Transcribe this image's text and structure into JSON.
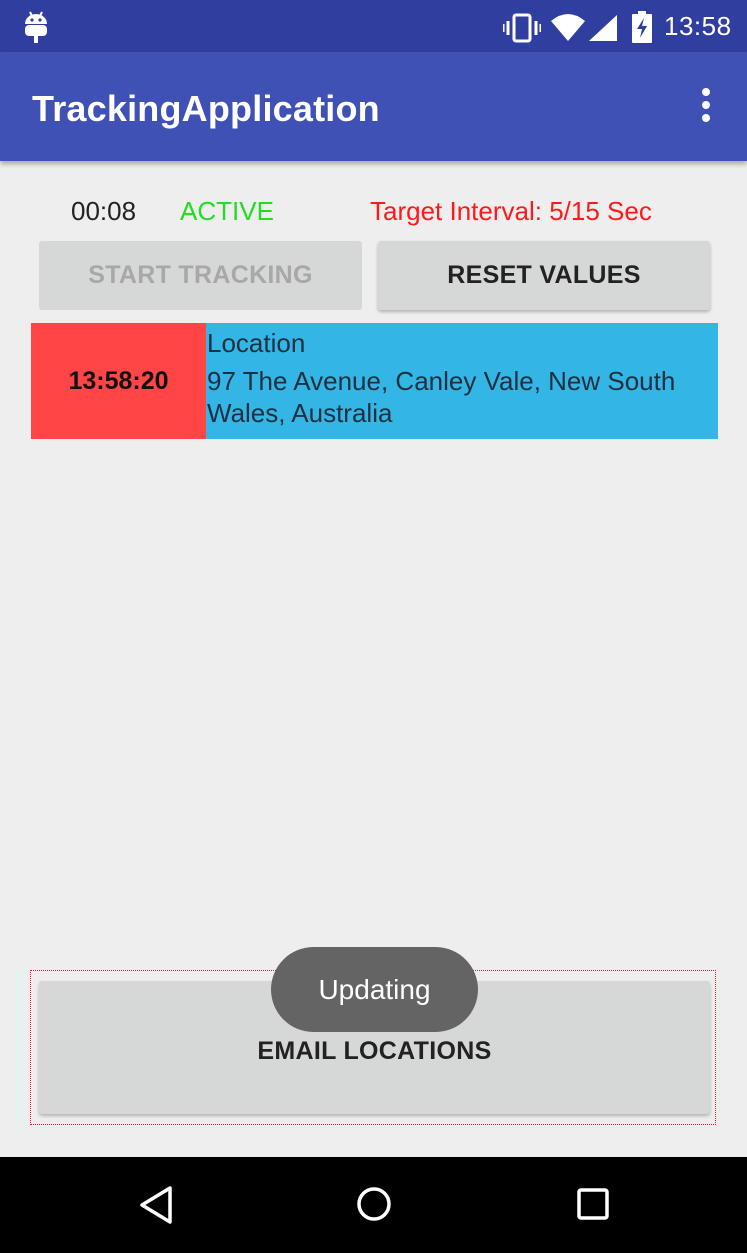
{
  "status_bar": {
    "time": "13:58",
    "icons": [
      "android-debug-icon",
      "vibrate-icon",
      "wifi-icon",
      "cell-signal-icon",
      "battery-charging-icon"
    ]
  },
  "app_bar": {
    "title": "TrackingApplication",
    "overflow_icon": "more-vert-icon"
  },
  "tracking": {
    "elapsed": "00:08",
    "state": "ACTIVE",
    "state_color": "#22dd22",
    "interval_text": "Target Interval: 5/15 Sec",
    "interval_color": "#ff1a1a"
  },
  "buttons": {
    "start_tracking": "START TRACKING",
    "reset_values": "RESET VALUES",
    "email_locations": "EMAIL LOCATIONS"
  },
  "locations": [
    {
      "time": "13:58:20",
      "label": "Location",
      "address": "97 The Avenue, Canley Vale, New South Wales, Australia"
    }
  ],
  "toast": {
    "message": "Updating"
  },
  "colors": {
    "primary": "#3f51b5",
    "primary_dark": "#303f9f",
    "time_cell": "#ff4545",
    "location_cell": "#33b5e5"
  },
  "nav_bar": {
    "icons": [
      "back-icon",
      "home-icon",
      "recents-icon"
    ]
  }
}
